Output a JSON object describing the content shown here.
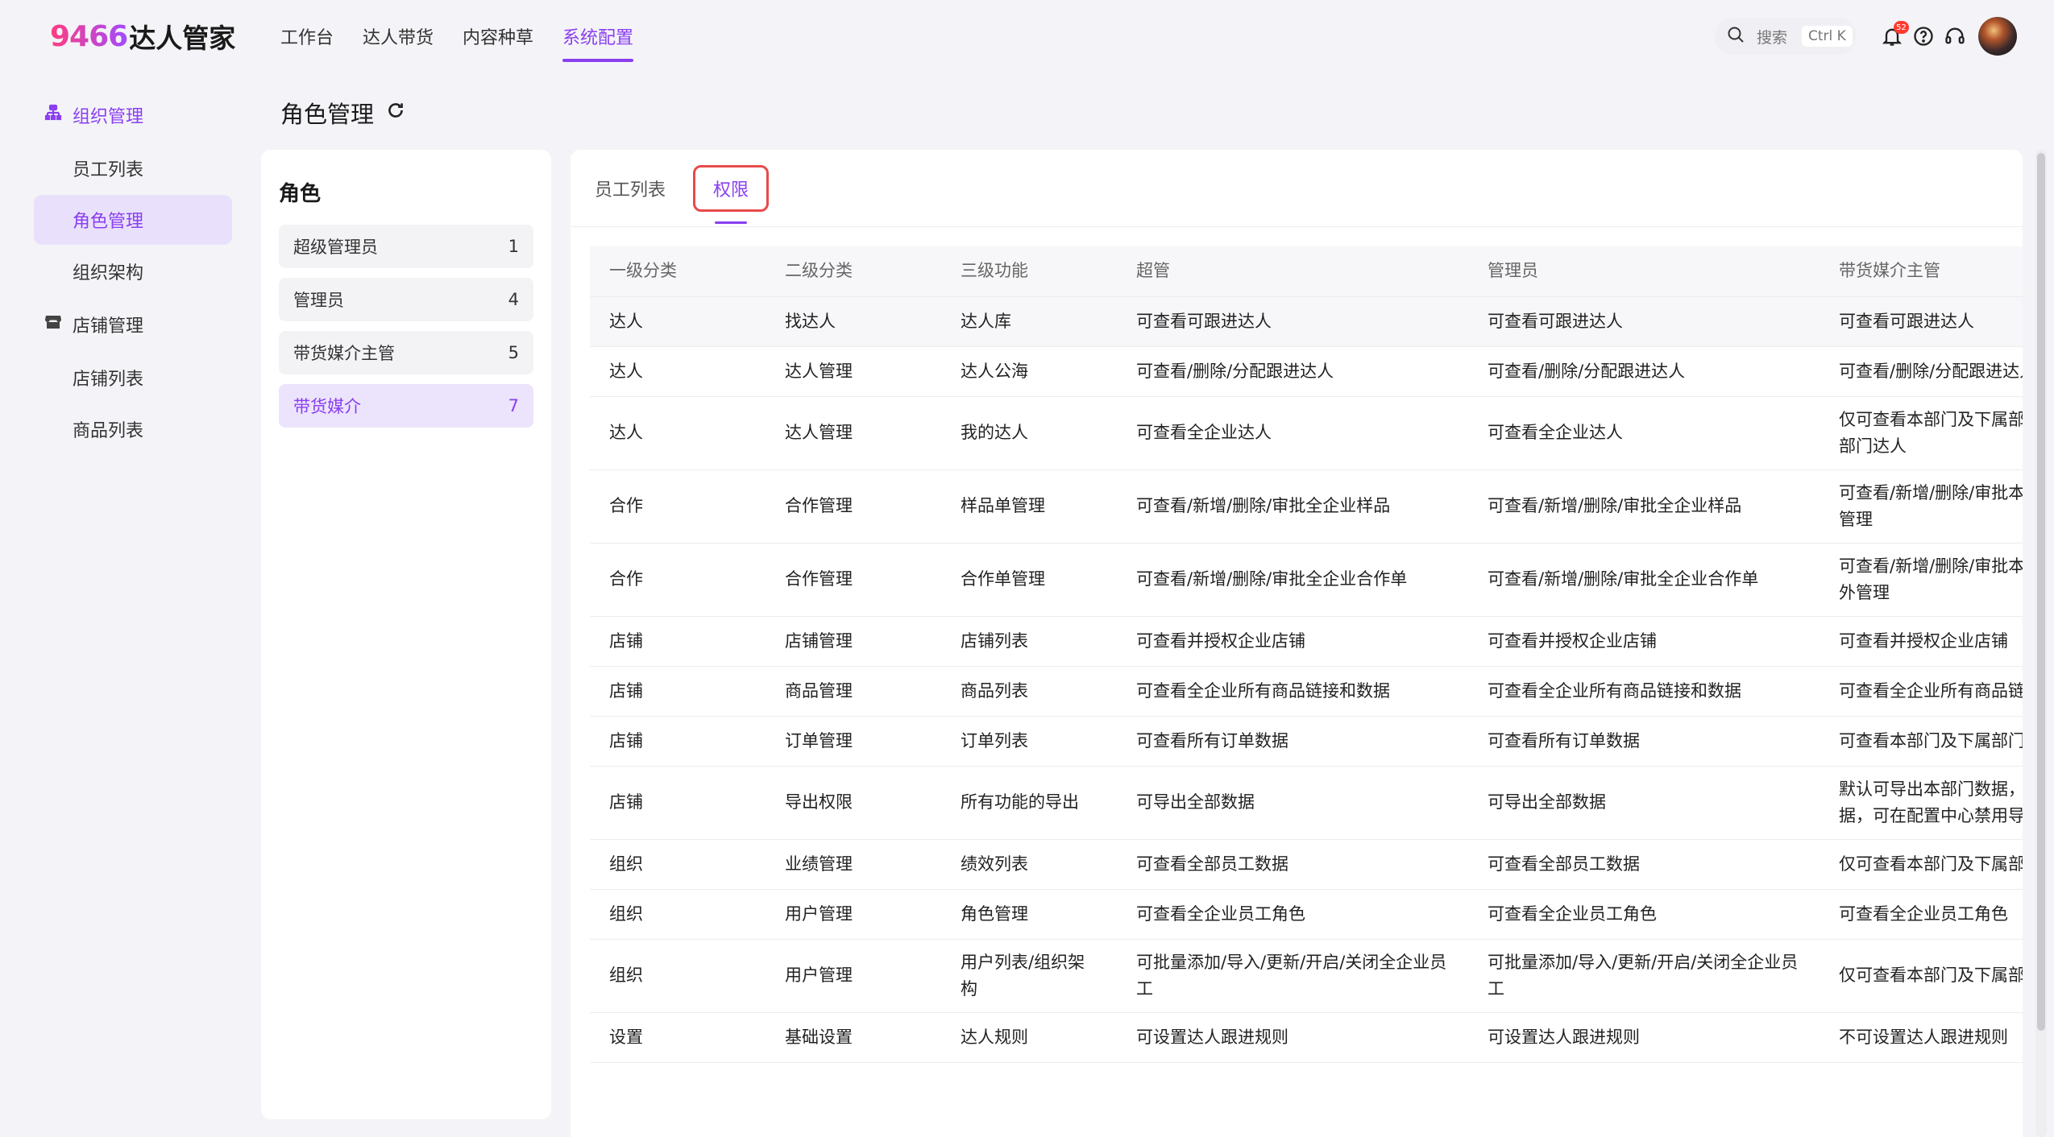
{
  "header": {
    "logo_number": "9466",
    "logo_text": "达人管家",
    "nav": [
      "工作台",
      "达人带货",
      "内容种草",
      "系统配置"
    ],
    "active_nav": 3,
    "search_placeholder": "搜索",
    "search_shortcut": "Ctrl K",
    "notification_count": "52",
    "icons": [
      "search-icon",
      "bell-icon",
      "help-icon",
      "headset-icon",
      "avatar"
    ]
  },
  "sidebar": {
    "groups": [
      {
        "label": "组织管理",
        "icon": "org-icon",
        "items": [
          "员工列表",
          "角色管理",
          "组织架构"
        ]
      },
      {
        "label": "店铺管理",
        "icon": "store-icon",
        "items": [
          "店铺列表",
          "商品列表"
        ]
      }
    ],
    "active_item": "角色管理"
  },
  "page": {
    "title": "角色管理"
  },
  "roles": {
    "title": "角色",
    "items": [
      {
        "name": "超级管理员",
        "count": "1"
      },
      {
        "name": "管理员",
        "count": "4"
      },
      {
        "name": "带货媒介主管",
        "count": "5"
      },
      {
        "name": "带货媒介",
        "count": "7"
      }
    ],
    "active": 3
  },
  "tabs": {
    "items": [
      "员工列表",
      "权限"
    ],
    "active": 1
  },
  "table": {
    "headers": [
      "一级分类",
      "二级分类",
      "三级功能",
      "超管",
      "管理员",
      "带货媒介主管"
    ],
    "rows": [
      [
        "达人",
        "找达人",
        "达人库",
        "可查看可跟进达人",
        "可查看可跟进达人",
        "可查看可跟进达人"
      ],
      [
        "达人",
        "达人管理",
        "达人公海",
        "可查看/删除/分配跟进达人",
        "可查看/删除/分配跟进达人",
        "可查看/删除/分配跟进达人"
      ],
      [
        "达人",
        "达人管理",
        "我的达人",
        "可查看全企业达人",
        "可查看全企业达人",
        "仅可查看本部门及下属部门达人，部门负责人可以操作本部门达人"
      ],
      [
        "合作",
        "合作管理",
        "样品单管理",
        "可查看/新增/删除/审批全企业样品",
        "可查看/新增/删除/审批全企业样品",
        "可查看/新增/删除/审批本部门样品，部门负责人可以额外管理"
      ],
      [
        "合作",
        "合作管理",
        "合作单管理",
        "可查看/新增/删除/审批全企业合作单",
        "可查看/新增/删除/审批全企业合作单",
        "可查看/新增/删除/审批本部门合作单，部门负责人可以额外管理"
      ],
      [
        "店铺",
        "店铺管理",
        "店铺列表",
        "可查看并授权企业店铺",
        "可查看并授权企业店铺",
        "可查看并授权企业店铺"
      ],
      [
        "店铺",
        "商品管理",
        "商品列表",
        "可查看全企业所有商品链接和数据",
        "可查看全企业所有商品链接和数据",
        "可查看全企业所有商品链接和所属部门的合作数据"
      ],
      [
        "店铺",
        "订单管理",
        "订单列表",
        "可查看所有订单数据",
        "可查看所有订单数据",
        "可查看本部门及下属部门订单数据"
      ],
      [
        "店铺",
        "导出权限",
        "所有功能的导出",
        "可导出全部数据",
        "可导出全部数据",
        "默认可导出本部门数据，负责人可导出本部及下属部门数据，可在配置中心禁用导出"
      ],
      [
        "组织",
        "业绩管理",
        "绩效列表",
        "可查看全部员工数据",
        "可查看全部员工数据",
        "仅可查看本部门及下属部门员工数据"
      ],
      [
        "组织",
        "用户管理",
        "角色管理",
        "可查看全企业员工角色",
        "可查看全企业员工角色",
        "可查看全企业员工角色"
      ],
      [
        "组织",
        "用户管理",
        "用户列表/组织架构",
        "可批量添加/导入/更新/开启/关闭全企业员工",
        "可批量添加/导入/更新/开启/关闭全企业员工",
        "仅可查看本部门及下属部门员工"
      ],
      [
        "设置",
        "基础设置",
        "达人规则",
        "可设置达人跟进规则",
        "可设置达人跟进规则",
        "不可设置达人跟进规则"
      ]
    ]
  }
}
